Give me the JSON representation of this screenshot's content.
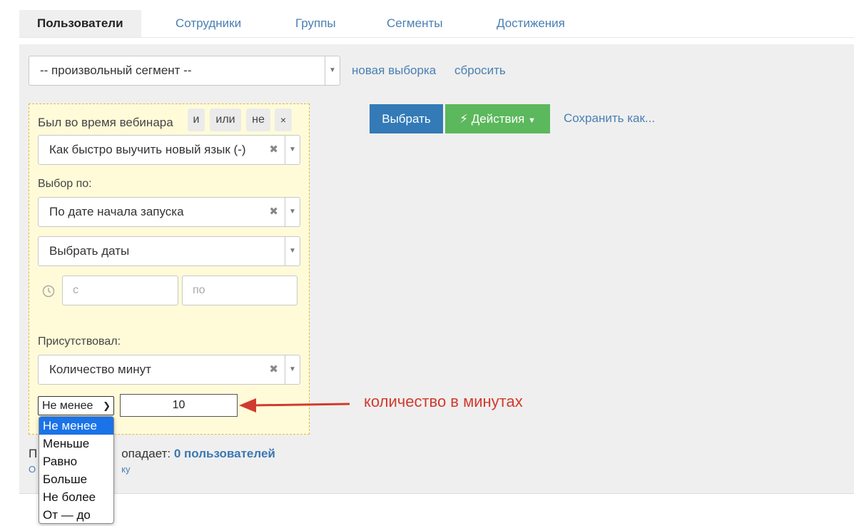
{
  "tabs": [
    {
      "label": "Пользователи",
      "active": true
    },
    {
      "label": "Сотрудники"
    },
    {
      "label": "Группы"
    },
    {
      "label": "Сегменты"
    },
    {
      "label": "Достижения"
    }
  ],
  "segment": {
    "selected": "-- произвольный сегмент --",
    "new_link": "новая выборка",
    "reset_link": "сбросить"
  },
  "filter": {
    "title": "Был во время вебинара",
    "ops": [
      "и",
      "или",
      "не",
      "×"
    ],
    "webinar": "Как быстро выучить новый язык (-)",
    "choose_by_label": "Выбор по:",
    "choose_by": "По дате начала запуска",
    "dates_select": "Выбрать даты",
    "date_from_placeholder": "с",
    "date_to_placeholder": "по",
    "attended_label": "Присутствовал:",
    "attended": "Количество минут",
    "comparison": "Не менее",
    "minutes_value": "10",
    "comparison_options": [
      "Не менее",
      "Меньше",
      "Равно",
      "Больше",
      "Не более",
      "От — до"
    ]
  },
  "actions": {
    "select_button": "Выбрать",
    "actions_button": "Действия",
    "save_as_link": "Сохранить как..."
  },
  "annotation": "количество в минутах",
  "footer": {
    "match_prefix_visible": "П",
    "match_suffix_visible": "опадает:",
    "match_count": "0 пользователей",
    "link_prefix_visible": "О",
    "link_suffix_visible": "ку"
  },
  "colors": {
    "primary_button": "#337ab7",
    "success_button": "#5cb85c",
    "annotation": "#d23a2f",
    "filter_bg": "#fffbd9"
  }
}
